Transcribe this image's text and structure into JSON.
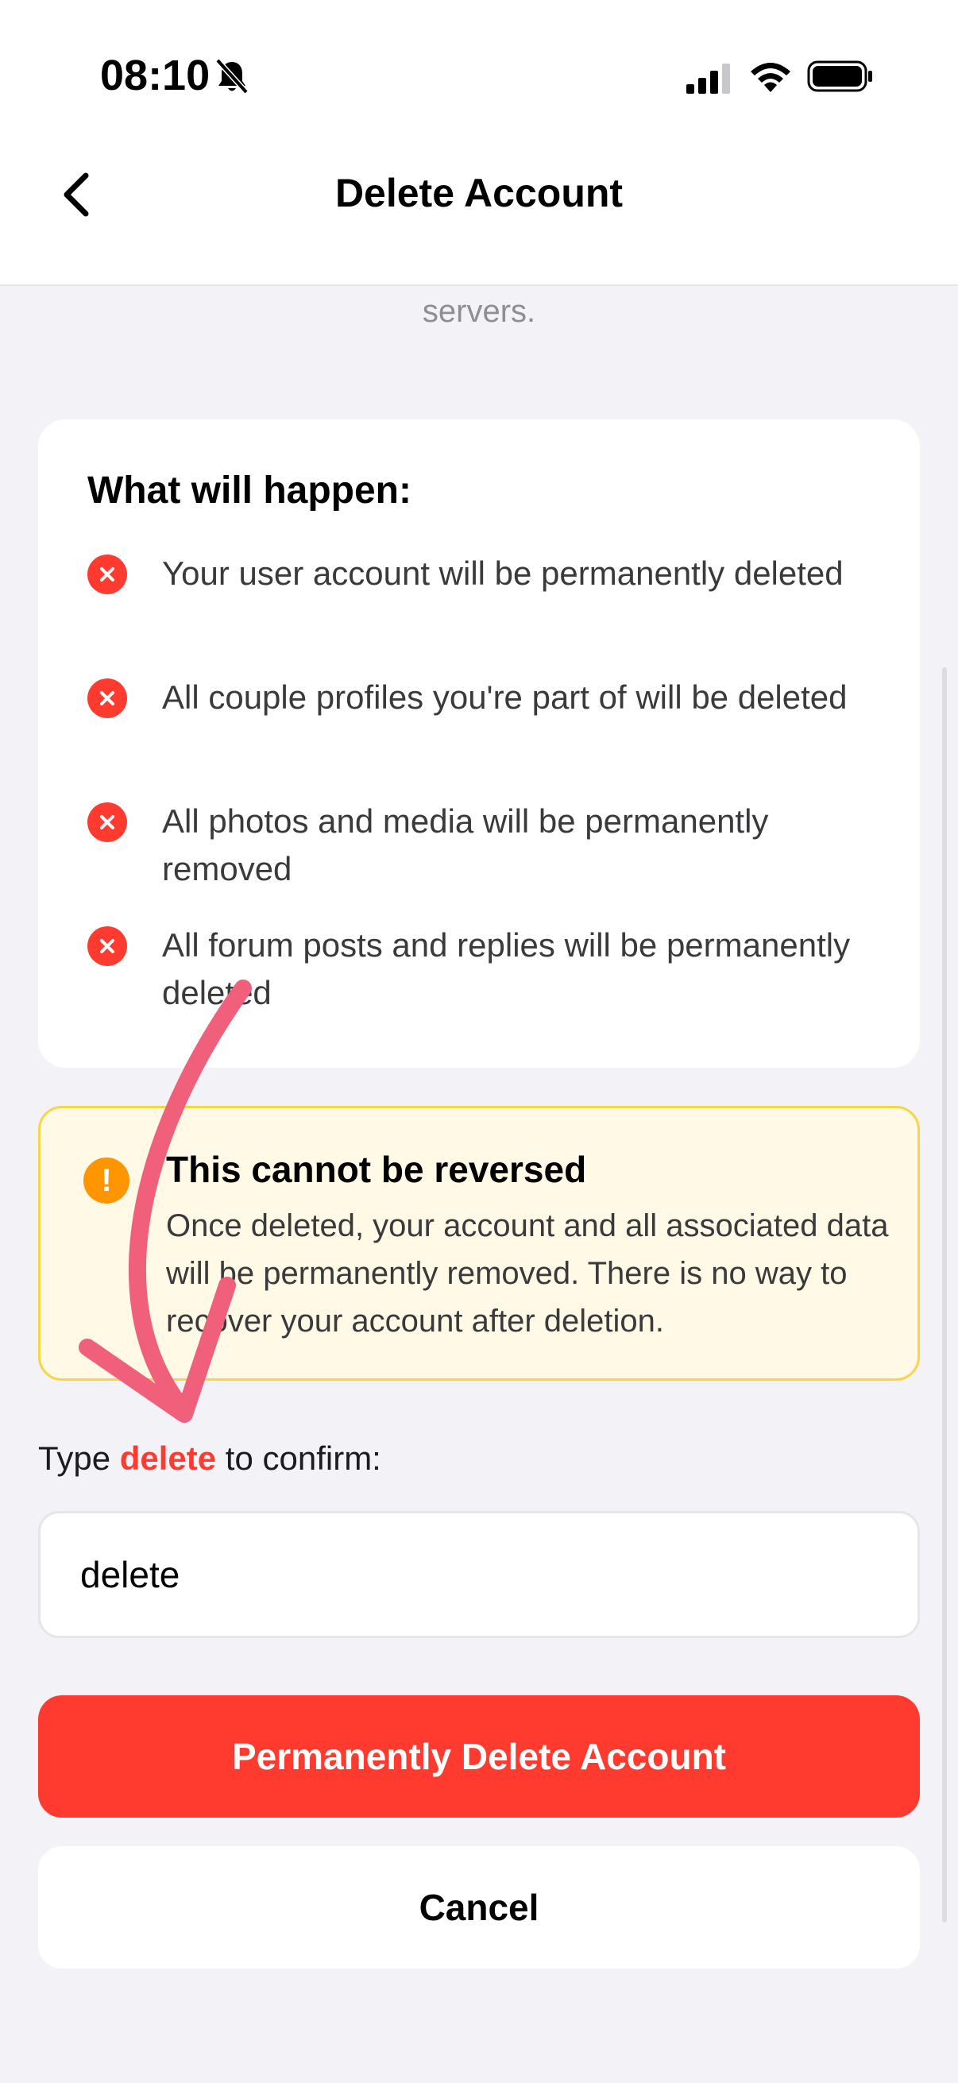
{
  "status_bar": {
    "time": "08:10",
    "icons": [
      "bell-slash-icon",
      "signal-icon",
      "wifi-icon",
      "battery-icon"
    ]
  },
  "nav": {
    "title": "Delete Account",
    "back_icon": "chevron-left-icon"
  },
  "intro_tail": "servers.",
  "consequences": {
    "title": "What will happen:",
    "items": [
      {
        "icon": "x-circle-icon",
        "text": "Your user account will be permanently deleted"
      },
      {
        "icon": "x-circle-icon",
        "text": "All couple profiles you're part of will be deleted"
      },
      {
        "icon": "x-circle-icon",
        "text": "All photos and media will be permanently removed"
      },
      {
        "icon": "x-circle-icon",
        "text": "All forum posts and replies will be permanently deleted"
      }
    ]
  },
  "warning": {
    "icon": "exclamation-circle-icon",
    "title": "This cannot be reversed",
    "body": "Once deleted, your account and all associated data will be permanently removed. There is no way to recover your account after deletion."
  },
  "confirm": {
    "prefix": "Type ",
    "keyword": "delete",
    "suffix": " to confirm:",
    "input_value": "delete"
  },
  "buttons": {
    "delete_label": "Permanently Delete Account",
    "cancel_label": "Cancel"
  },
  "colors": {
    "destructive": "#ff3b30",
    "warning_bg": "#fff9e6",
    "warning_border": "#f7d54a",
    "warning_icon": "#ff9500",
    "background": "#f2f2f7",
    "annotation_arrow": "#f0607a"
  }
}
